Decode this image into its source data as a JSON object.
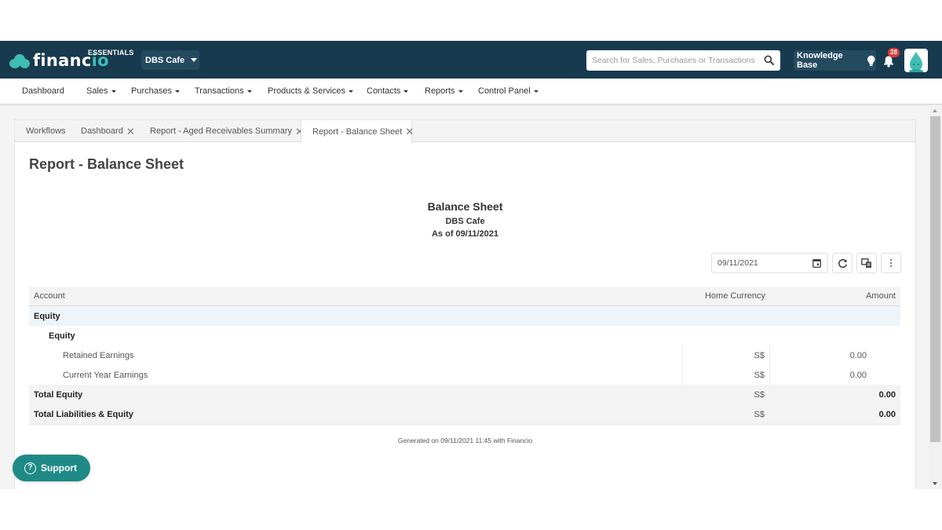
{
  "app": {
    "brand_prefix": "financ",
    "brand_suffix": "io",
    "edition": "ESSENTIALS",
    "company": "DBS Cafe"
  },
  "header": {
    "search_placeholder": "Search for Sales, Purchases or Transactions",
    "knowledge_base_label": "Knowledge Base",
    "notification_count": "28",
    "colors": {
      "topbar": "#173a4f",
      "accent": "#3fbdb2",
      "badge": "#e53935"
    }
  },
  "nav": {
    "items": [
      {
        "label": "Dashboard",
        "dropdown": false
      },
      {
        "label": "Sales",
        "dropdown": true
      },
      {
        "label": "Purchases",
        "dropdown": true
      },
      {
        "label": "Transactions",
        "dropdown": true
      },
      {
        "label": "Products & Services",
        "dropdown": true
      },
      {
        "label": "Contacts",
        "dropdown": true
      },
      {
        "label": "Reports",
        "dropdown": true
      },
      {
        "label": "Control Panel",
        "dropdown": true
      }
    ]
  },
  "tabs": [
    {
      "label": "Workflows",
      "closable": false,
      "active": false
    },
    {
      "label": "Dashboard",
      "closable": true,
      "active": false
    },
    {
      "label": "Report - Aged Receivables Summary",
      "closable": true,
      "active": false
    },
    {
      "label": "Report - Balance Sheet",
      "closable": true,
      "active": true
    }
  ],
  "page": {
    "title": "Report - Balance Sheet"
  },
  "report": {
    "title": "Balance Sheet",
    "company": "DBS Cafe",
    "as_of": "As of 09/11/2021",
    "date_value": "09/11/2021",
    "columns": {
      "account": "Account",
      "currency": "Home Currency",
      "amount": "Amount"
    },
    "rows": [
      {
        "type": "group",
        "account": "Equity",
        "currency": "",
        "amount": ""
      },
      {
        "type": "sub",
        "account": "Equity",
        "currency": "",
        "amount": ""
      },
      {
        "type": "item",
        "account": "Retained Earnings",
        "currency": "S$",
        "amount": "0.00"
      },
      {
        "type": "item",
        "account": "Current Year Earnings",
        "currency": "S$",
        "amount": "0.00"
      },
      {
        "type": "total",
        "account": "Total Equity",
        "currency": "S$",
        "amount": "0.00"
      },
      {
        "type": "total",
        "account": "Total Liabilities & Equity",
        "currency": "S$",
        "amount": "0.00"
      }
    ],
    "generated": "Generated on 09/11/2021 11:45 with Financio"
  },
  "support": {
    "label": "Support"
  }
}
